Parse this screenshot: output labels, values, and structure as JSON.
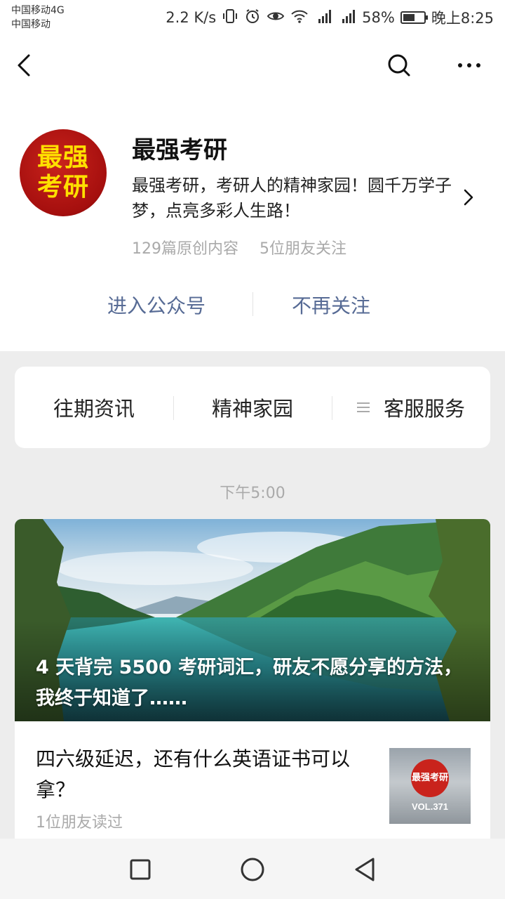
{
  "status_bar": {
    "carrier_1": "中国移动4G",
    "carrier_2": "中国移动",
    "speed": "2.2 K/s",
    "battery": "58%",
    "battery_level": 0.58,
    "time": "晚上8:25"
  },
  "header": {
    "back_icon": "chevron-left-icon",
    "search_icon": "search-icon",
    "more_icon": "more-icon"
  },
  "profile": {
    "avatar_text": "最强考研",
    "name": "最强考研",
    "description": "最强考研，考研人的精神家园！圆千万学子梦，点亮多彩人生路！",
    "original_count": "129篇原创内容",
    "friends_following": "5位朋友关注",
    "enter_label": "进入公众号",
    "unfollow_label": "不再关注"
  },
  "menu": {
    "items": [
      {
        "label": "往期资讯"
      },
      {
        "label": "精神家园"
      },
      {
        "label": "客服服务"
      }
    ]
  },
  "feed": {
    "timestamp": "下午5:00",
    "hero_title": "4 天背完 5500 考研词汇，研友不愿分享的方法，我终于知道了……",
    "sub_title": "四六级延迟，还有什么英语证书可以拿？",
    "sub_meta": "1位朋友读过",
    "thumb_badge": "最强考研",
    "thumb_vol": "VOL.371"
  },
  "colors": {
    "link": "#576b95",
    "avatar_red": "#c9231c",
    "avatar_text": "#ffe000"
  }
}
